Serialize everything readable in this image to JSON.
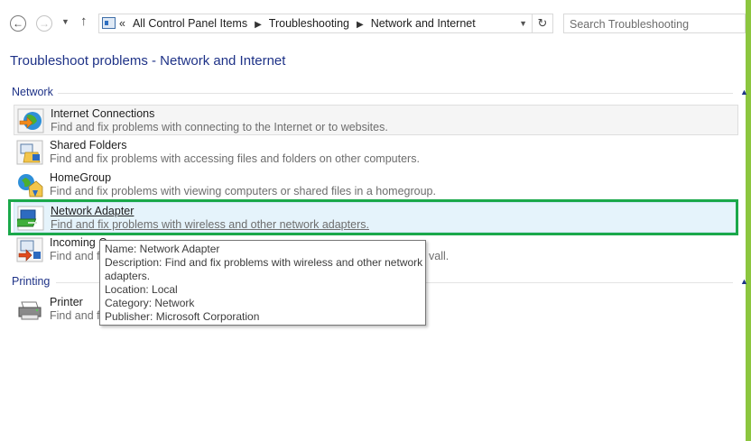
{
  "nav": {
    "back_icon": "back-arrow-icon",
    "forward_icon": "forward-arrow-icon",
    "up_icon": "up-arrow-icon"
  },
  "address": {
    "lead": "«",
    "crumbs": [
      "All Control Panel Items",
      "Troubleshooting",
      "Network and Internet"
    ]
  },
  "search": {
    "placeholder": "Search Troubleshooting"
  },
  "page_title": "Troubleshoot problems - Network and Internet",
  "groups": [
    {
      "label": "Network",
      "items": [
        {
          "name": "Internet Connections",
          "desc": "Find and fix problems with connecting to the Internet or to websites."
        },
        {
          "name": "Shared Folders",
          "desc": "Find and fix problems with accessing files and folders on other computers."
        },
        {
          "name": "HomeGroup",
          "desc": "Find and fix problems with viewing computers or shared files in a homegroup."
        },
        {
          "name": "Network Adapter",
          "desc": "Find and fix problems with wireless and other network adapters."
        },
        {
          "name": "Incoming Co",
          "desc_left": "Find and fi",
          "desc_right": "vall."
        }
      ]
    },
    {
      "label": "Printing",
      "items": [
        {
          "name": "Printer",
          "desc": "Find and fi"
        }
      ]
    }
  ],
  "tooltip": {
    "name": "Name: Network Adapter",
    "description_1": "Description: Find and fix problems with wireless and other network",
    "description_2": "adapters.",
    "location": "Location: Local",
    "category": "Category: Network",
    "publisher": "Publisher: Microsoft Corporation"
  },
  "colors": {
    "accent_text": "#1e3287",
    "highlight_box": "#1aa84a",
    "desktop_bg": "#8cc63f",
    "selected_bg": "#e5f3fb"
  }
}
